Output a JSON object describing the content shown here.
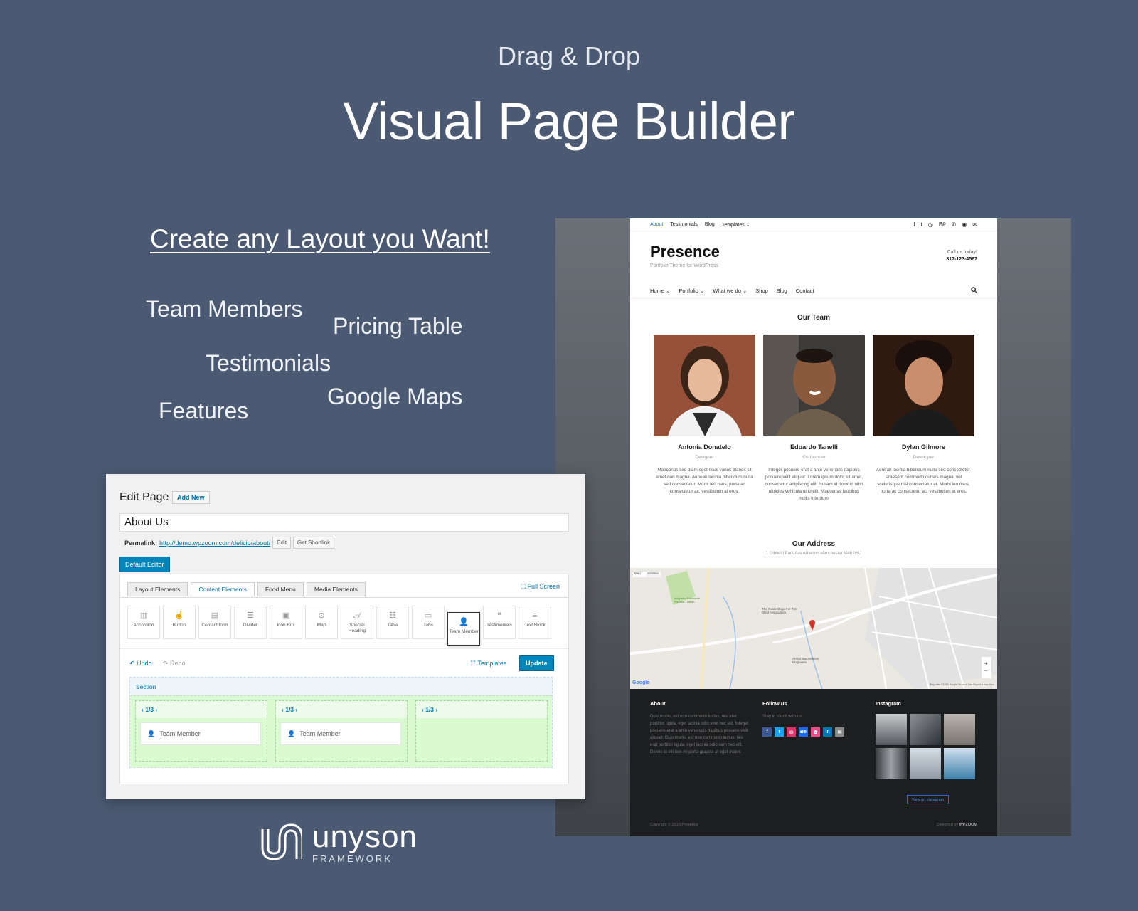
{
  "hero": {
    "subtitle": "Drag & Drop",
    "title": "Visual Page Builder"
  },
  "tagline": "Create any Layout you Want!",
  "features": [
    "Team Members",
    "Pricing Table",
    "Testimonials",
    "Google Maps",
    "Features"
  ],
  "preview": {
    "topbar": {
      "links": [
        "About",
        "Testimonials",
        "Blog",
        "Templates ⌄"
      ],
      "social_icons": [
        "f",
        "t",
        "◎",
        "Bē",
        "✆",
        "◉",
        "✉"
      ]
    },
    "brand": {
      "name": "Presence",
      "tagline": "Portfolio Theme for WordPress"
    },
    "contact": {
      "label": "Call us today!",
      "phone": "817-123-4567"
    },
    "nav": [
      "Home ⌄",
      "Portfolio ⌄",
      "What we do ⌄",
      "Shop",
      "Blog",
      "Contact"
    ],
    "team_title": "Our Team",
    "members": [
      {
        "name": "Antonia Donatelo",
        "role": "Designer",
        "bio": "Maecenas sed diam eget risus varius blandit sit amet non magna. Aenean lacinia bibendum nulla sed consectetur. Morbi leo risus, porta ac consectetur ac, vestibulum at eros."
      },
      {
        "name": "Eduardo Tanelli",
        "role": "Co-founder",
        "bio": "Integer posuere erat a ante venenatis dapibus posuere velit aliquet. Lorem ipsum dolor sit amet, consectetur adipiscing elit. Nullam id dolor id nibh ultricies vehicula ut id elit. Maecenas faucibus mollis interdum."
      },
      {
        "name": "Dylan Gilmore",
        "role": "Developer",
        "bio": "Aenean lacinia bibendum nulla sed consectetur. Praesent commodo cursus magna, vel scelerisque nisl consectetur et. Morbi leo risus, porta ac consectetur ac, vestibulum at eros."
      }
    ],
    "address_title": "Our Address",
    "address": "1 Gibfield Park Ave Atherton Manchester M46 0SU",
    "map": {
      "tabs": [
        "Map",
        "Satellite"
      ],
      "labels": [
        "The Guide Dogs For The Blind Association",
        "Arthur Stephenson Engineers",
        "Antipasto Ristorante Pizzeria - Italian",
        "Google",
        "Map data ©2016 Google  Terms of Use  Report a map error"
      ]
    },
    "footer": {
      "about_title": "About",
      "about_text": "Duis mollis, est non commodo luctus, nisi erat porttitor ligula, eget lacinia odio sem nec elit. Integer posuere erat a ante venenatis dapibus posuere velit aliquet. Duis mollis, est non commodo luctus, nisi erat porttitor ligula, eget lacinia odio sem nec elit. Donec id elit non mi porta gravida at eget metus.",
      "follow_title": "Follow us",
      "follow_text": "Stay in touch with us",
      "social": [
        {
          "label": "f",
          "color": "#3b5998"
        },
        {
          "label": "t",
          "color": "#1da1f2"
        },
        {
          "label": "◎",
          "color": "#e1306c"
        },
        {
          "label": "Bē",
          "color": "#1769ff"
        },
        {
          "label": "✿",
          "color": "#ea4c89"
        },
        {
          "label": "in",
          "color": "#0077b5"
        },
        {
          "label": "✉",
          "color": "#888888"
        }
      ],
      "instagram_title": "Instagram",
      "view_button": "View on Instagram",
      "copyright": "Copyright © 2016 Presence",
      "designed_by": "Designed by",
      "designer": "WPZOOM"
    }
  },
  "editor": {
    "title": "Edit Page",
    "add_new": "Add New",
    "page_title": "About Us",
    "permalink_label": "Permalink:",
    "permalink_url": "http://demo.wpzoom.com/delicio/about/",
    "edit": "Edit",
    "shortlink": "Get Shortlink",
    "default_editor": "Default Editor",
    "tabs": [
      "Layout Elements",
      "Content Elements",
      "Food Menu",
      "Media Elements"
    ],
    "fullscreen": "Full Screen",
    "elements": [
      {
        "label": "Accordion",
        "icon": "▥"
      },
      {
        "label": "Button",
        "icon": "☝"
      },
      {
        "label": "Contact form",
        "icon": "▤"
      },
      {
        "label": "Divider",
        "icon": "☰"
      },
      {
        "label": "Icon Box",
        "icon": "▣"
      },
      {
        "label": "Map",
        "icon": "⊙"
      },
      {
        "label": "Special Heading",
        "icon": "𝒜"
      },
      {
        "label": "Table",
        "icon": "☷"
      },
      {
        "label": "Tabs",
        "icon": "▭"
      },
      {
        "label": "Team Member",
        "icon": "👤"
      },
      {
        "label": "Testimonials",
        "icon": "❝"
      },
      {
        "label": "Text Block",
        "icon": "≡"
      }
    ],
    "undo": "↶ Undo",
    "redo": "↷ Redo",
    "templates": "Templates",
    "update": "Update",
    "section": "Section",
    "columns": [
      "1/3",
      "1/3",
      "1/3"
    ],
    "team_member": "Team Member"
  },
  "logo": {
    "name": "unyson",
    "sub": "FRAMEWORK"
  }
}
